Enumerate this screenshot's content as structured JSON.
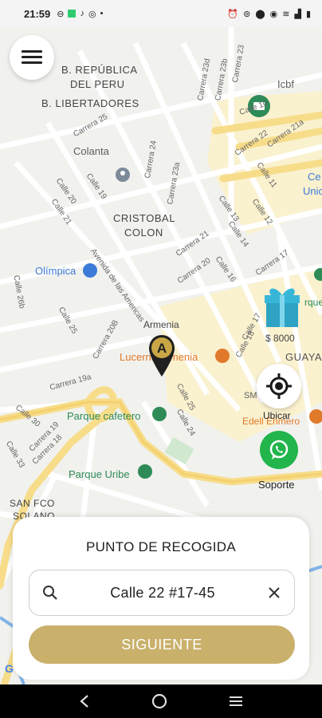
{
  "status_bar": {
    "time": "21:59",
    "notification_icons": [
      "vpn-icon",
      "app-square-icon",
      "tiktok-icon",
      "instagram-icon",
      "dot-icon"
    ],
    "system_icons": [
      "alarm-icon",
      "hotspot-icon",
      "location-icon",
      "eye-icon",
      "wifi-icon",
      "signal-icon",
      "battery-icon"
    ]
  },
  "map": {
    "labels": {
      "b_republica_1": "B. REPÚBLICA",
      "b_republica_2": "DEL PERU",
      "b_libertadores": "B. LIBERTADORES",
      "colanta": "Colanta",
      "cristobal_1": "CRISTOBAL",
      "cristobal_2": "COLON",
      "olimpica": "Olímpica",
      "armenia": "Armenia",
      "lucerna": "Lucerna Armenia",
      "guayaq": "GUAYAQ",
      "parque_cafetero": "Parque cafetero",
      "parque_uribe": "Parque Uribe",
      "san_fco_1": "SAN FCO",
      "san_fco_2": "SOLANO",
      "icbf": "Icbf",
      "ce": "Ce",
      "unic": "Unic",
      "edell": "Edell Enmero",
      "rque": "rque",
      "sm": "SM"
    },
    "streets": {
      "carrera_23d": "Carrera 23d",
      "carrera_23b": "Carrera 23b",
      "carrera_23": "Carrera 23",
      "calle_10": "Calle 10",
      "carrera_22": "Carrera 22",
      "carrera_21a": "Carrera 21a",
      "carrera_25": "Carrera 25",
      "carrera_24": "Carrera 24",
      "carrera_23a": "Carrera 23a",
      "calle_11": "Calle 11",
      "calle_20": "Calle 20",
      "calle_19": "Calle 19",
      "calle_21": "Calle 21",
      "calle_13": "Calle 13",
      "calle_12": "Calle 12",
      "carrera_21": "Carrera 21",
      "calle_14": "Calle 14",
      "carrera_20": "Carrera 20",
      "calle_16": "Calle 16",
      "carrera_17": "Carrera 17",
      "av_americas": "Avenida de las Americas",
      "calle_26b": "Calle 26b",
      "calle_25": "Calle 25",
      "carrera_20b": "Carrera 20B",
      "calle_17": "Calle 17",
      "calle_18": "Calle 18",
      "carrera_19a": "Carrera 19a",
      "calle_25b": "Calle 25",
      "calle_24": "Calle 24",
      "calle_30": "Calle 30",
      "carrera_19": "Carrera 19",
      "carrera_18": "Carrera 18",
      "calle_33": "Calle 33"
    },
    "pin_letter": "A"
  },
  "menu_button": {
    "icon": "hamburger-menu-icon"
  },
  "promo": {
    "price": "$ 8000",
    "icon": "gift-icon"
  },
  "locate": {
    "label": "Ubicar",
    "icon": "crosshair-icon"
  },
  "support": {
    "label": "Soporte",
    "icon": "whatsapp-icon"
  },
  "sheet": {
    "heading": "PUNTO DE RECOGIDA",
    "address_value": "Calle 22 #17-45",
    "search_icon": "search-icon",
    "clear_icon": "close-icon",
    "next_label": "SIGUIENTE"
  },
  "google_logo": "G",
  "colors": {
    "accent_gold": "#c9b06b",
    "pin_gold": "#c9a646",
    "whatsapp_green": "#21b54b",
    "road_yellow": "#f7dd8a",
    "gift_teal": "#2fa3c4"
  },
  "nav_bar": {
    "icons": [
      "back-icon",
      "home-icon",
      "recents-icon"
    ]
  }
}
